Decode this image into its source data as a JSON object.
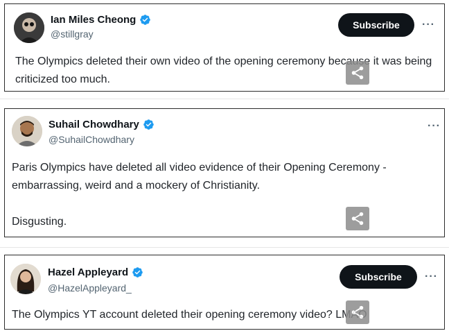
{
  "tweets": [
    {
      "name": "Ian Miles Cheong",
      "handle": "@stillgray",
      "subscribe_label": "Subscribe",
      "more": "···",
      "text": "The Olympics deleted their own video of the opening ceremony because it was being criticized too much.",
      "verified": true
    },
    {
      "name": "Suhail Chowdhary",
      "handle": "@SuhailChowdhary",
      "more": "···",
      "text": "Paris Olympics have deleted all video evidence of their Opening Ceremony - embarrassing, weird and a mockery of Christianity.\n\nDisgusting.",
      "verified": true
    },
    {
      "name": "Hazel Appleyard",
      "handle": "@HazelAppleyard_",
      "subscribe_label": "Subscribe",
      "more": "···",
      "text": "The Olympics YT account deleted their opening ceremony video? LMAO",
      "verified": true
    }
  ],
  "colors": {
    "verified_badge": "#1d9bf0",
    "subscribe_bg": "#0f1419",
    "share_bg": "#8d8d8d",
    "handle_text": "#536471"
  },
  "icons": {
    "verified": "verified-badge-icon",
    "share": "share-icon",
    "more": "more-icon"
  }
}
